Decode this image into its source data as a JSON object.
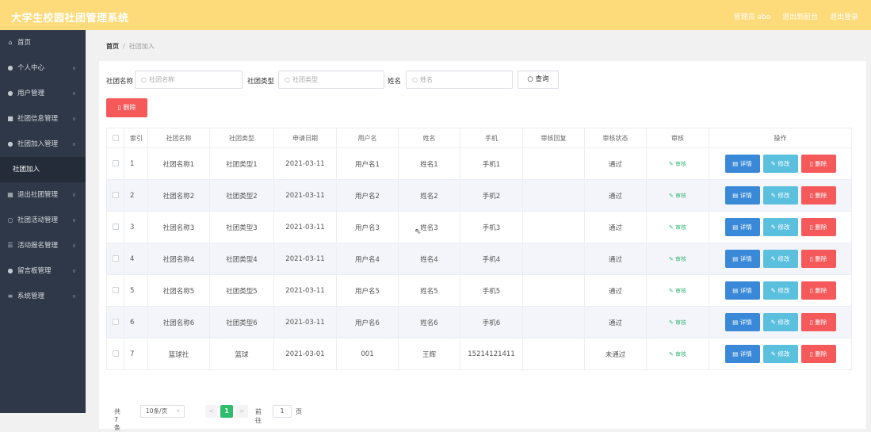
{
  "header": {
    "title": "大学生校园社团管理系统",
    "admin": "管理员 abo",
    "back_to_front": "退出到前台",
    "logout": "退出登录"
  },
  "sidebar": {
    "items": [
      {
        "label": "首页",
        "icon": "home-icon",
        "has_arrow": false
      },
      {
        "label": "个人中心",
        "icon": "user-icon",
        "has_arrow": true
      },
      {
        "label": "用户管理",
        "icon": "users-icon",
        "has_arrow": true
      },
      {
        "label": "社团信息管理",
        "icon": "list-icon",
        "has_arrow": true
      },
      {
        "label": "社团加入管理",
        "icon": "user-add-icon",
        "has_arrow": true,
        "expanded": true
      },
      {
        "label": "社团加入",
        "sub": true
      },
      {
        "label": "退出社团管理",
        "icon": "grid-icon",
        "has_arrow": true
      },
      {
        "label": "社团活动管理",
        "icon": "circle-icon",
        "has_arrow": true
      },
      {
        "label": "活动报名管理",
        "icon": "form-icon",
        "has_arrow": true
      },
      {
        "label": "留言板管理",
        "icon": "message-icon",
        "has_arrow": true
      },
      {
        "label": "系统管理",
        "icon": "menu-icon",
        "has_arrow": true
      }
    ]
  },
  "breadcrumb": {
    "home": "首页",
    "separator": "/",
    "current": "社团加入"
  },
  "search": {
    "club_name_label": "社团名称",
    "club_name_placeholder": "社团名称",
    "club_type_label": "社团类型",
    "club_type_placeholder": "社团类型",
    "name_label": "姓名",
    "name_placeholder": "姓名",
    "query_button": "查询"
  },
  "batch_delete_button": "删除",
  "table": {
    "headers": [
      "索引",
      "社团名称",
      "社团类型",
      "申请日期",
      "用户名",
      "姓名",
      "手机",
      "审核回复",
      "审核状态",
      "审核",
      "操作"
    ],
    "rows": [
      {
        "index": "1",
        "club_name": "社团名称1",
        "club_type": "社团类型1",
        "date": "2021-03-11",
        "username": "用户名1",
        "name": "姓名1",
        "phone": "手机1",
        "reply": "",
        "status": "通过",
        "audit": "审核"
      },
      {
        "index": "2",
        "club_name": "社团名称2",
        "club_type": "社团类型2",
        "date": "2021-03-11",
        "username": "用户名2",
        "name": "姓名2",
        "phone": "手机2",
        "reply": "",
        "status": "通过",
        "audit": "审核"
      },
      {
        "index": "3",
        "club_name": "社团名称3",
        "club_type": "社团类型3",
        "date": "2021-03-11",
        "username": "用户名3",
        "name": "姓名3",
        "phone": "手机3",
        "reply": "",
        "status": "通过",
        "audit": "审核"
      },
      {
        "index": "4",
        "club_name": "社团名称4",
        "club_type": "社团类型4",
        "date": "2021-03-11",
        "username": "用户名4",
        "name": "姓名4",
        "phone": "手机4",
        "reply": "",
        "status": "通过",
        "audit": "审核"
      },
      {
        "index": "5",
        "club_name": "社团名称5",
        "club_type": "社团类型5",
        "date": "2021-03-11",
        "username": "用户名5",
        "name": "姓名5",
        "phone": "手机5",
        "reply": "",
        "status": "通过",
        "audit": "审核"
      },
      {
        "index": "6",
        "club_name": "社团名称6",
        "club_type": "社团类型6",
        "date": "2021-03-11",
        "username": "用户名6",
        "name": "姓名6",
        "phone": "手机6",
        "reply": "",
        "status": "通过",
        "audit": "审核"
      },
      {
        "index": "7",
        "club_name": "篮球社",
        "club_type": "篮球",
        "date": "2021-03-01",
        "username": "001",
        "name": "王辉",
        "phone": "15214121411",
        "reply": "",
        "status": "未通过",
        "audit": "审核"
      }
    ],
    "actions": {
      "detail": "详情",
      "edit": "修改",
      "delete": "删除"
    }
  },
  "pagination": {
    "total": "共 7 条",
    "page_size": "10条/页",
    "prev": "<",
    "current_page": "1",
    "next": ">",
    "goto_label": "前往",
    "goto_value": "1",
    "page_unit": "页"
  },
  "colors": {
    "topbar": "#fddb7a",
    "sidebar": "#2f3848",
    "primary": "#3a89d9",
    "info": "#5ac0de",
    "danger": "#f5595a",
    "success": "#2dbe6c"
  }
}
